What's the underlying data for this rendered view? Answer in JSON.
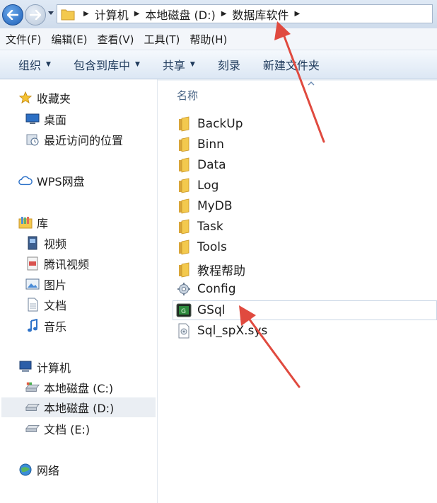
{
  "address": {
    "crumbs": [
      "计算机",
      "本地磁盘 (D:)",
      "数据库软件"
    ]
  },
  "menu": [
    "文件(F)",
    "编辑(E)",
    "查看(V)",
    "工具(T)",
    "帮助(H)"
  ],
  "toolbar": {
    "organize": "组织",
    "include_library": "包含到库中",
    "share": "共享",
    "burn": "刻录",
    "new_folder": "新建文件夹"
  },
  "nav": {
    "favorites": "收藏夹",
    "desktop": "桌面",
    "recent": "最近访问的位置",
    "wps": "WPS网盘",
    "library": "库",
    "video": "视频",
    "tencent_video": "腾讯视频",
    "pictures": "图片",
    "documents": "文档",
    "music": "音乐",
    "computer": "计算机",
    "drive_c": "本地磁盘 (C:)",
    "drive_d": "本地磁盘 (D:)",
    "drive_e": "文档 (E:)",
    "network": "网络"
  },
  "content": {
    "column_name": "名称",
    "files": [
      "BackUp",
      "Binn",
      "Data",
      "Log",
      "MyDB",
      "Task",
      "Tools",
      "教程帮助",
      "Config",
      "GSql",
      "Sql_spX.sys"
    ]
  },
  "colors": {
    "accent": "#1d5fb8",
    "arrow": "#e04a3f",
    "folder": "#f3c94e"
  }
}
